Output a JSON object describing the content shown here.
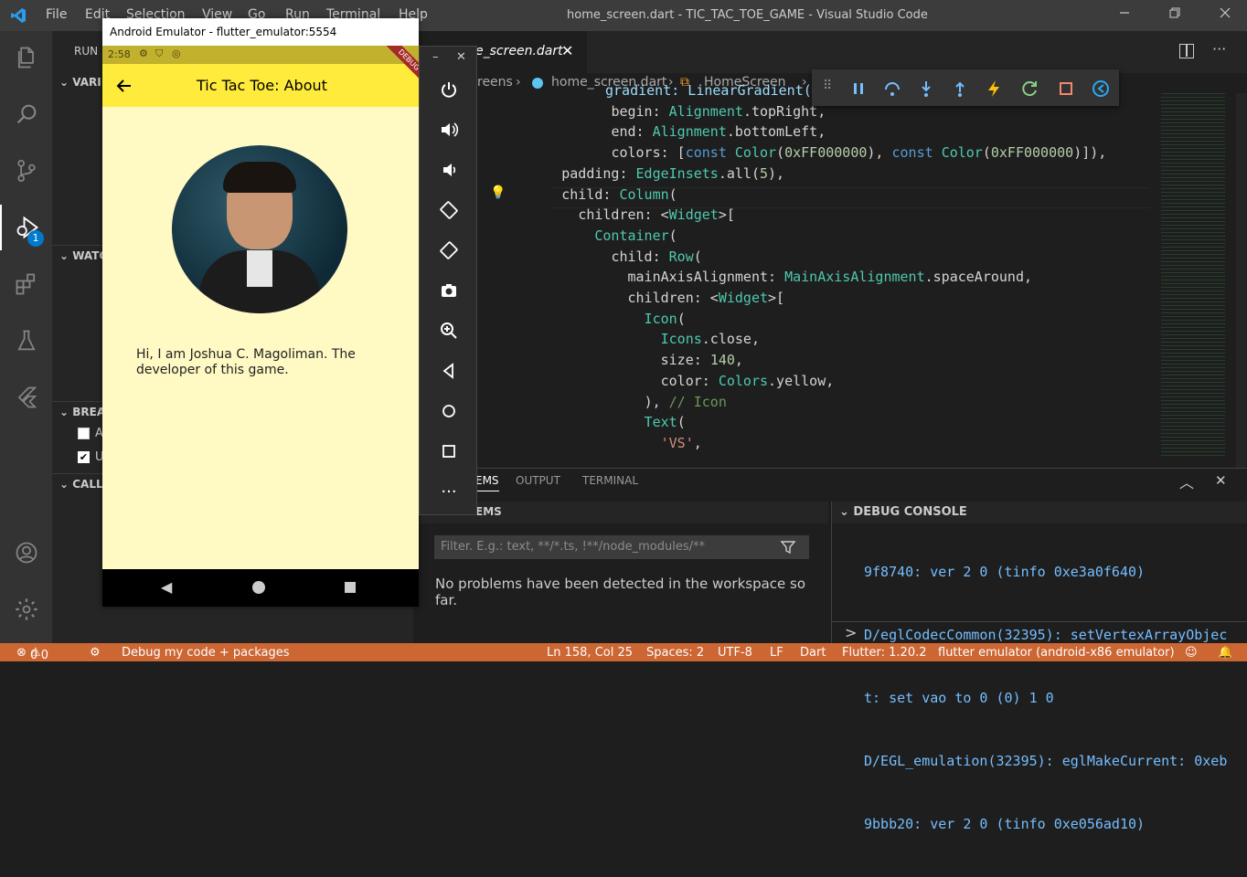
{
  "window": {
    "menu": [
      "File",
      "Edit",
      "Selection",
      "View",
      "Go",
      "Run",
      "Terminal",
      "Help"
    ],
    "title": "home_screen.dart - TIC_TAC_TOE_GAME - Visual Studio Code"
  },
  "activity": {
    "debug_badge": "1"
  },
  "sidebar": {
    "run_label": "RUN",
    "sections": [
      "VARI",
      "WATC",
      "BREA",
      "CALL"
    ],
    "bp1": "A",
    "bp2": "U"
  },
  "editor": {
    "tab_label": "e_screen.dart",
    "breadcrumb": [
      "reens",
      "home_screen.dart",
      "HomeScreen"
    ]
  },
  "code": [
    {
      "indent": "",
      "parts": [
        [
          "gradient: LinearGradient(",
          "p"
        ]
      ]
    },
    {
      "indent": "              ",
      "parts": [
        [
          "begin: ",
          ""
        ],
        [
          "Alignment",
          "c"
        ],
        [
          ".topRight,",
          ""
        ]
      ]
    },
    {
      "indent": "              ",
      "parts": [
        [
          "end: ",
          ""
        ],
        [
          "Alignment",
          "c"
        ],
        [
          ".bottomLeft,",
          ""
        ]
      ]
    },
    {
      "indent": "              ",
      "parts": [
        [
          "colors: [",
          ""
        ],
        [
          "const ",
          "k"
        ],
        [
          "Color",
          "c"
        ],
        [
          "(",
          ""
        ],
        [
          "0xFF000000",
          "n"
        ],
        [
          "), ",
          ""
        ],
        [
          "const ",
          "k"
        ],
        [
          "Color",
          "c"
        ],
        [
          "(",
          ""
        ],
        [
          "0xFF000000",
          "n"
        ],
        [
          ")]),",
          ""
        ]
      ]
    },
    {
      "indent": "        ",
      "parts": [
        [
          "padding: ",
          ""
        ],
        [
          "EdgeInsets",
          "c"
        ],
        [
          ".all(",
          ""
        ],
        [
          "5",
          "n"
        ],
        [
          "),",
          ""
        ]
      ]
    },
    {
      "indent": "        ",
      "parts": [
        [
          "child: ",
          ""
        ],
        [
          "Column",
          "c"
        ],
        [
          "(",
          ""
        ]
      ]
    },
    {
      "indent": "          ",
      "parts": [
        [
          "children: <",
          ""
        ],
        [
          "Widget",
          "c"
        ],
        [
          ">[",
          ""
        ]
      ]
    },
    {
      "indent": "            ",
      "parts": [
        [
          "Container",
          "c"
        ],
        [
          "(",
          ""
        ]
      ]
    },
    {
      "indent": "              ",
      "parts": [
        [
          "child: ",
          ""
        ],
        [
          "Row",
          "c"
        ],
        [
          "(",
          ""
        ]
      ]
    },
    {
      "indent": "                ",
      "parts": [
        [
          "mainAxisAlignment: ",
          ""
        ],
        [
          "MainAxisAlignment",
          "c"
        ],
        [
          ".spaceAround,",
          ""
        ]
      ]
    },
    {
      "indent": "                ",
      "parts": [
        [
          "children: <",
          ""
        ],
        [
          "Widget",
          "c"
        ],
        [
          ">[",
          ""
        ]
      ]
    },
    {
      "indent": "                  ",
      "parts": [
        [
          "Icon",
          "c"
        ],
        [
          "(",
          ""
        ]
      ]
    },
    {
      "indent": "                    ",
      "parts": [
        [
          "Icons",
          "c"
        ],
        [
          ".close,",
          ""
        ]
      ]
    },
    {
      "indent": "                    ",
      "parts": [
        [
          "size: ",
          ""
        ],
        [
          "140",
          "n"
        ],
        [
          ",",
          ""
        ]
      ]
    },
    {
      "indent": "                    ",
      "parts": [
        [
          "color: ",
          ""
        ],
        [
          "Colors",
          "c"
        ],
        [
          ".yellow,",
          ""
        ]
      ]
    },
    {
      "indent": "                  ",
      "parts": [
        [
          "), ",
          ""
        ],
        [
          "// Icon",
          "cm"
        ]
      ]
    },
    {
      "indent": "                  ",
      "parts": [
        [
          "Text",
          "c"
        ],
        [
          "(",
          ""
        ]
      ]
    },
    {
      "indent": "                    ",
      "parts": [
        [
          "'VS'",
          "s"
        ],
        [
          ",",
          ""
        ]
      ]
    }
  ],
  "panel": {
    "tabs": [
      "EMS",
      "OUTPUT",
      "TERMINAL"
    ],
    "problems_header": "EMS",
    "filter_placeholder": "Filter. E.g.: text, **/*.ts, !**/node_modules/**",
    "no_problems": "No problems have been detected in the workspace so far.",
    "debug_console_title": "DEBUG CONSOLE",
    "console_lines": [
      "9f8740: ver 2 0 (tinfo 0xe3a0f640)",
      "D/eglCodecCommon(32395): setVertexArrayObjec",
      "t: set vao to 0 (0) 1 0",
      "D/EGL_emulation(32395): eglMakeCurrent: 0xeb",
      "9bbb20: ver 2 0 (tinfo 0xe056ad10)"
    ],
    "prompt": ">"
  },
  "status": {
    "errors": "0",
    "warnings": "0",
    "debug_label": "Debug my code + packages",
    "position": "Ln 158, Col 25",
    "spaces": "Spaces: 2",
    "encoding": "UTF-8",
    "eol": "LF",
    "language": "Dart",
    "flutter": "Flutter: 1.20.2",
    "device": "flutter emulator (android-x86 emulator)"
  },
  "emulator": {
    "window_title": "Android Emulator - flutter_emulator:5554",
    "time": "2:58",
    "debug_ribbon": "DEBUG",
    "app_title": "Tic Tac Toe: About",
    "about_text": "Hi, I am Joshua C. Magoliman. The developer of this game."
  },
  "colors": {
    "accent": "#ffeb3b",
    "app_bg": "#fff9c4",
    "status_bg": "#cc6633"
  }
}
